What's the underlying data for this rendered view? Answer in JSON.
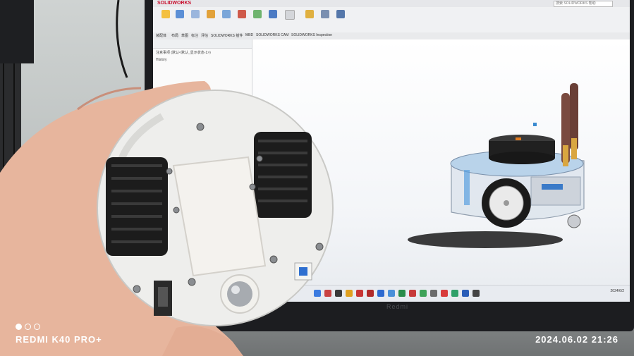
{
  "photo": {
    "subject": "Hand holding 3D-printed round robot chassis in front of a monitor showing a CAD model",
    "watermark_left": "REDMI K40 PRO+",
    "watermark_right": "2024.06.02  21:26"
  },
  "monitor": {
    "brand": "Redmi",
    "app_logo": "SOLIDWORKS",
    "title": "",
    "search_placeholder": "搜索 SOLIDWORKS 帮助",
    "tabs": [
      "装配体",
      "布局",
      "草图",
      "标注",
      "评估",
      "SOLIDWORKS 插件",
      "MBD",
      "SOLIDWORKS CAM",
      "SOLIDWORKS Inspection"
    ],
    "tree_items": [
      "注意事项 (默认<默认_显示状态-1>)",
      "History"
    ],
    "clock": {
      "time": "",
      "date": "2024/6/2"
    }
  },
  "colors": {
    "accent": "#c8102e",
    "chassis": "#eeeeec",
    "wheel": "#1c1c1c",
    "skin": "#e8b39a"
  },
  "icons": [
    "ribbon-icon",
    "taskbar-icon",
    "screw-icon",
    "switch-icon",
    "button-icon",
    "ball-caster-icon"
  ]
}
